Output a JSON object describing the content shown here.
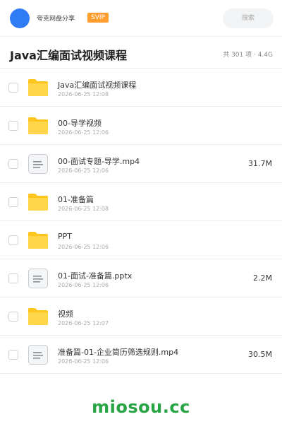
{
  "header": {
    "brand_name": "夸克网盘分享",
    "badge": "SVIP",
    "search_placeholder": "搜索"
  },
  "folder": {
    "title": "Java汇编面试视频课程",
    "summary": "共 301 项 · 4.4G"
  },
  "files": [
    {
      "type": "folder",
      "name": "Java汇编面试视频课程",
      "date": "2026-06-25 12:08",
      "size": ""
    },
    {
      "type": "folder",
      "name": "00-导学视频",
      "date": "2026-06-25 12:06",
      "size": ""
    },
    {
      "type": "doc",
      "name": "00-面试专题-导学.mp4",
      "date": "2026-06-25 12:06",
      "size": "31.7M"
    },
    {
      "type": "folder",
      "name": "01-准备篇",
      "date": "2026-06-25 12:08",
      "size": ""
    },
    {
      "type": "folder",
      "name": "PPT",
      "date": "2026-06-25 12:06",
      "size": ""
    },
    {
      "type": "doc",
      "name": "01-面试-准备篇.pptx",
      "date": "2026-06-25 12:06",
      "size": "2.2M"
    },
    {
      "type": "folder",
      "name": "视频",
      "date": "2026-06-25 12:07",
      "size": ""
    },
    {
      "type": "doc",
      "name": "准备篇-01-企业简历筛选规则.mp4",
      "date": "2026-06-25 12:06",
      "size": "30.5M"
    }
  ],
  "footer": {
    "watermark": "miosou.cc"
  },
  "colors": {
    "avatar": "#2f7cf6",
    "badge": "#ff9d2e",
    "folder": "#ffc51f",
    "watermark": "#27a444"
  }
}
